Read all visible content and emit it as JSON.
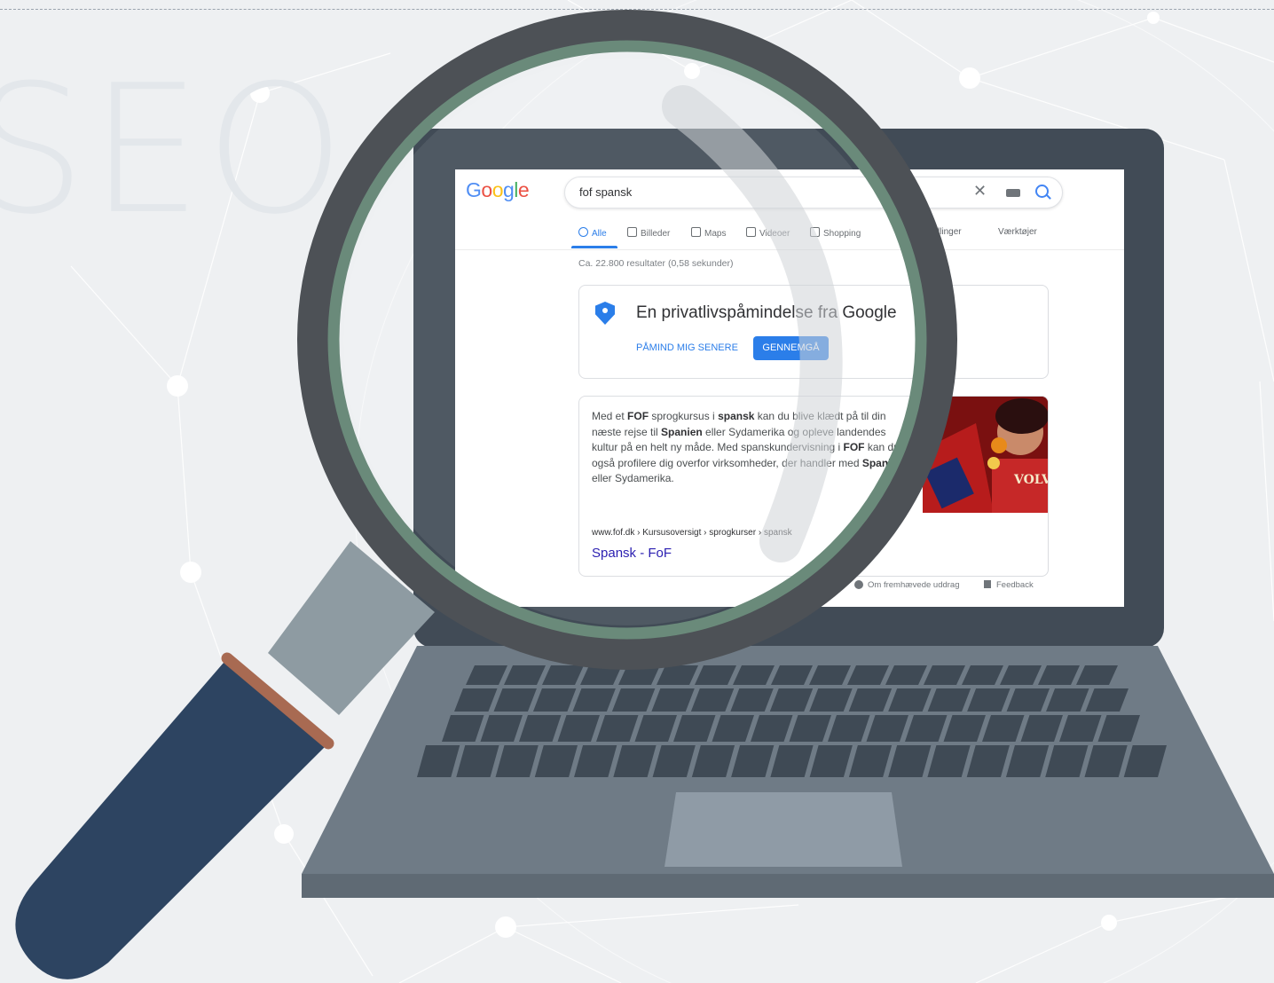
{
  "background": {
    "word": "SEO",
    "color": "#eef0f2"
  },
  "laptop": {
    "lid_color": "#414b56",
    "base_color": "#6f7b86",
    "key_color": "#3f4a55",
    "trackpad_color": "#8f9ba6"
  },
  "google": {
    "logo_letters": [
      {
        "ch": "G",
        "color": "#4285f4"
      },
      {
        "ch": "o",
        "color": "#ea4335"
      },
      {
        "ch": "o",
        "color": "#fbbc05"
      },
      {
        "ch": "g",
        "color": "#4285f4"
      },
      {
        "ch": "l",
        "color": "#34a853"
      },
      {
        "ch": "e",
        "color": "#ea4335"
      }
    ],
    "search_query": "fof spansk",
    "tabs": [
      {
        "label": "Alle",
        "icon": "search-icon"
      },
      {
        "label": "Billeder",
        "icon": "image-icon"
      },
      {
        "label": "Maps",
        "icon": "pin-icon"
      },
      {
        "label": "Videoer",
        "icon": "video-icon"
      },
      {
        "label": "Shopping",
        "icon": "tag-icon"
      },
      {
        "label": "Indstillinger",
        "icon": ""
      },
      {
        "label": "Værktøjer",
        "icon": ""
      }
    ],
    "result_count": "Ca. 22.800 resultater (0,58 sekunder)",
    "privacy": {
      "title": "En privatlivspåmindelse fra Google",
      "later_label": "PÅMIND MIG SENERE",
      "review_label": "GENNEMGÅ"
    },
    "snippet": {
      "url": "www.fof.dk › Kursusoversigt › sprogkurser › spansk",
      "link_title": "Spansk - FoF",
      "image_text": "VOLVER"
    },
    "footer": {
      "about": "Om fremhævede uddrag",
      "feedback": "Feedback"
    }
  },
  "magnifier": {
    "frame_color": "#4d5156",
    "ring_color": "#6a8a7a",
    "neck_color": "#8e9ba2",
    "handle_color": "#2d4461",
    "band_color": "#a86a52"
  }
}
